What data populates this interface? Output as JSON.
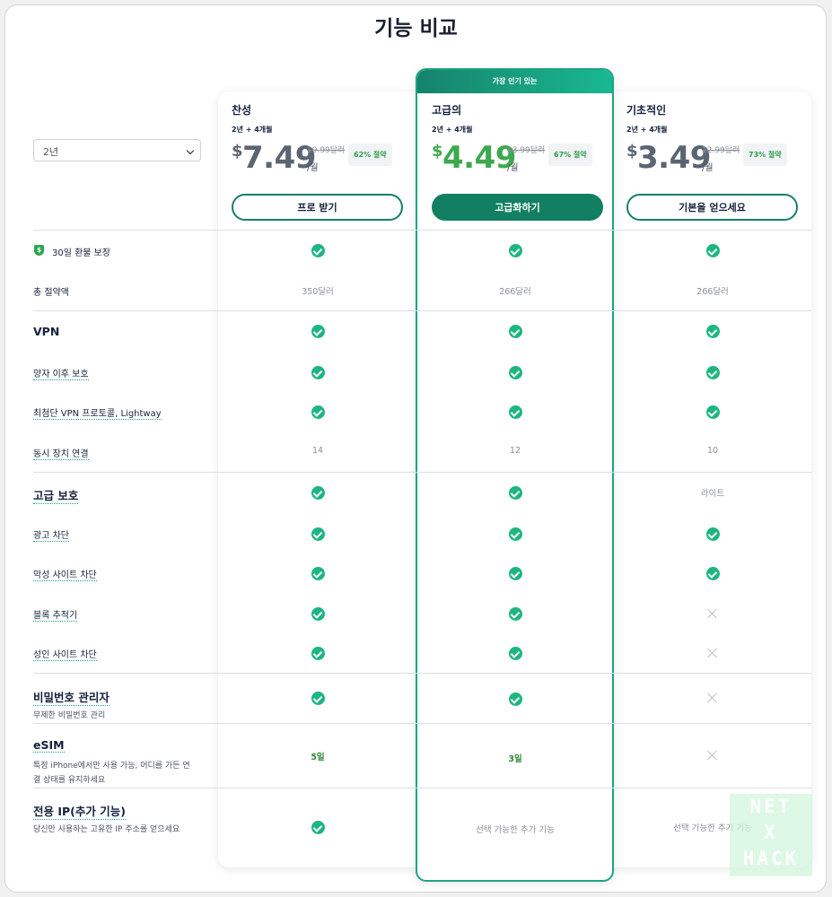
{
  "page": {
    "title": "기능 비교"
  },
  "term_select": {
    "value": "2년"
  },
  "popular_badge": "가장 인기 있는",
  "plans": [
    {
      "name": "찬성",
      "term": "2년 + 4개월",
      "currency": "$",
      "price": "7.49",
      "old_price": "19.99달러",
      "per": "/월",
      "save": "62% 절약",
      "button": "프로 받기"
    },
    {
      "name": "고급의",
      "term": "2년 + 4개월",
      "currency": "$",
      "price": "4.49",
      "old_price": "13.99달러",
      "per": "/월",
      "save": "67% 절약",
      "button": "고급화하기"
    },
    {
      "name": "기초적인",
      "term": "2년 + 4개월",
      "currency": "$",
      "price": "3.49",
      "old_price": "12.99달러",
      "per": "/월",
      "save": "73% 절약",
      "button": "기본을 얻으세요"
    }
  ],
  "features": {
    "money_back": {
      "label": "30일 환불 보장",
      "shield": "$"
    },
    "total_savings": {
      "label": "총 절약액",
      "values": [
        "350달러",
        "266달러",
        "266달러"
      ]
    },
    "vpn": {
      "label": "VPN"
    },
    "post_quantum": {
      "label": "양자 이후 보호"
    },
    "lightway": {
      "label": "최첨단 VPN 프로토콜, Lightway"
    },
    "devices": {
      "label": "동시 장치 연결",
      "values": [
        "14",
        "12",
        "10"
      ]
    },
    "advanced_protection": {
      "label": "고급 보호",
      "basic_value": "라이트"
    },
    "ad_block": {
      "label": "광고 차단"
    },
    "malicious_block": {
      "label": "악성 사이트 차단"
    },
    "tracker_block": {
      "label": "블록 추적기"
    },
    "adult_block": {
      "label": "성인 사이트 차단"
    },
    "password_manager": {
      "label": "비밀번호 관리자",
      "sub": "무제한 비밀번호 관리"
    },
    "esim": {
      "label": "eSIM",
      "sub_line1": "특정 iPhone에서만 사용 가능, 어디를 가든 연",
      "sub_line2": "결 상태를 유지하세요",
      "values": [
        "5일",
        "3일"
      ]
    },
    "dedicated_ip": {
      "label": "전용 IP(추가 기능)",
      "sub": "당신만 사용하는 고유한 IP 주소를 얻으세요",
      "optional": "선택 가능한 추가 기능"
    }
  },
  "watermark": {
    "line1": "NET",
    "line2": "X",
    "line3": "HACK"
  },
  "colors": {
    "accent": "#127f63",
    "check": "#1db67f",
    "price_green": "#3da94e"
  }
}
